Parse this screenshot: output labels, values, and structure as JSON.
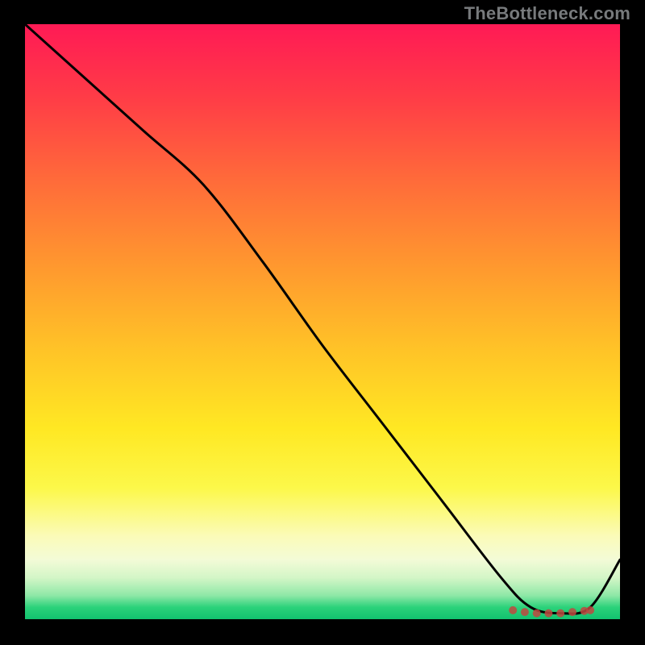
{
  "watermark": "TheBottleneck.com",
  "chart_data": {
    "type": "line",
    "title": "",
    "xlabel": "",
    "ylabel": "",
    "xlim": [
      0,
      100
    ],
    "ylim": [
      0,
      100
    ],
    "grid": false,
    "legend": false,
    "series": [
      {
        "name": "bottleneck-curve",
        "x": [
          0,
          10,
          20,
          30,
          40,
          50,
          60,
          70,
          80,
          85,
          90,
          95,
          100
        ],
        "y": [
          100,
          91,
          82,
          73,
          60,
          46,
          33,
          20,
          7,
          2,
          1,
          2,
          10
        ]
      }
    ],
    "markers": {
      "name": "optimal-range",
      "x": [
        82,
        84,
        86,
        88,
        90,
        92,
        94,
        95
      ],
      "y": [
        1.5,
        1.2,
        1.0,
        1.0,
        1.0,
        1.2,
        1.4,
        1.5
      ]
    },
    "gradient_meaning": "vertical red-to-green indicating bottleneck severity (top=bad, bottom=good)"
  }
}
